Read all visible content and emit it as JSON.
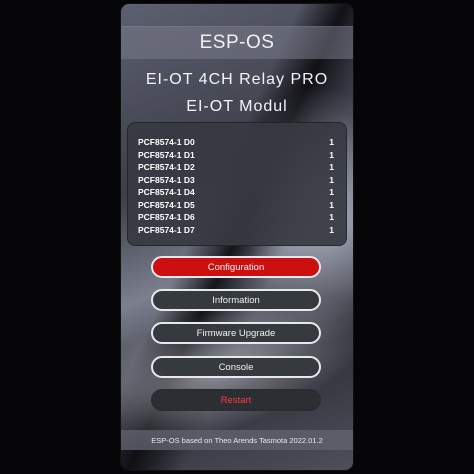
{
  "app": {
    "brand": "ESP-OS"
  },
  "device": {
    "title_line1": "EI-OT 4CH Relay PRO",
    "title_line2": "EI-OT Modul"
  },
  "status": {
    "rows": [
      {
        "label": "PCF8574-1 D0",
        "value": "1"
      },
      {
        "label": "PCF8574-1 D1",
        "value": "1"
      },
      {
        "label": "PCF8574-1 D2",
        "value": "1"
      },
      {
        "label": "PCF8574-1 D3",
        "value": "1"
      },
      {
        "label": "PCF8574-1 D4",
        "value": "1"
      },
      {
        "label": "PCF8574-1 D5",
        "value": "1"
      },
      {
        "label": "PCF8574-1 D6",
        "value": "1"
      },
      {
        "label": "PCF8574-1 D7",
        "value": "1"
      }
    ]
  },
  "menu": {
    "configuration": "Configuration",
    "information": "Information",
    "firmware_upgrade": "Firmware Upgrade",
    "console": "Console",
    "restart": "Restart"
  },
  "footer": {
    "text": "ESP-OS based on Theo Arends Tasmota 2022.01.2"
  },
  "colors": {
    "primary_button": "#cc1010",
    "restart_text": "#ff3b3b",
    "background": "#050507"
  }
}
